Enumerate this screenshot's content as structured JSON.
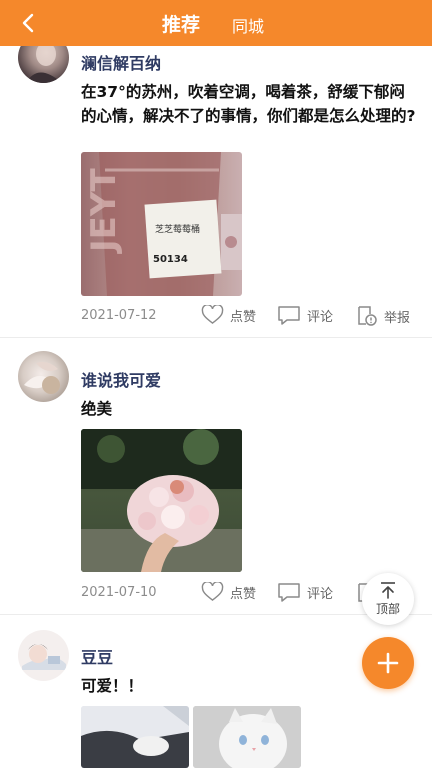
{
  "header": {
    "tab_recommend": "推荐",
    "tab_local": "同城"
  },
  "posts": [
    {
      "username": "澜信解百纳",
      "content": "在37°的苏州，吹着空调，喝着茶，舒缓下郁闷的心情，解决不了的事情，你们都是怎么处理的?",
      "date": "2021-07-12",
      "like_label": "点赞",
      "comment_label": "评论",
      "report_label": "举报",
      "photo_text_1": "芝芝莓莓桶",
      "photo_text_2": "50134"
    },
    {
      "username": "谁说我可爱",
      "content": "绝美",
      "date": "2021-07-10",
      "like_label": "点赞",
      "comment_label": "评论"
    },
    {
      "username": "豆豆",
      "content": "可爱！！"
    }
  ],
  "floating": {
    "top_label": "顶部"
  }
}
